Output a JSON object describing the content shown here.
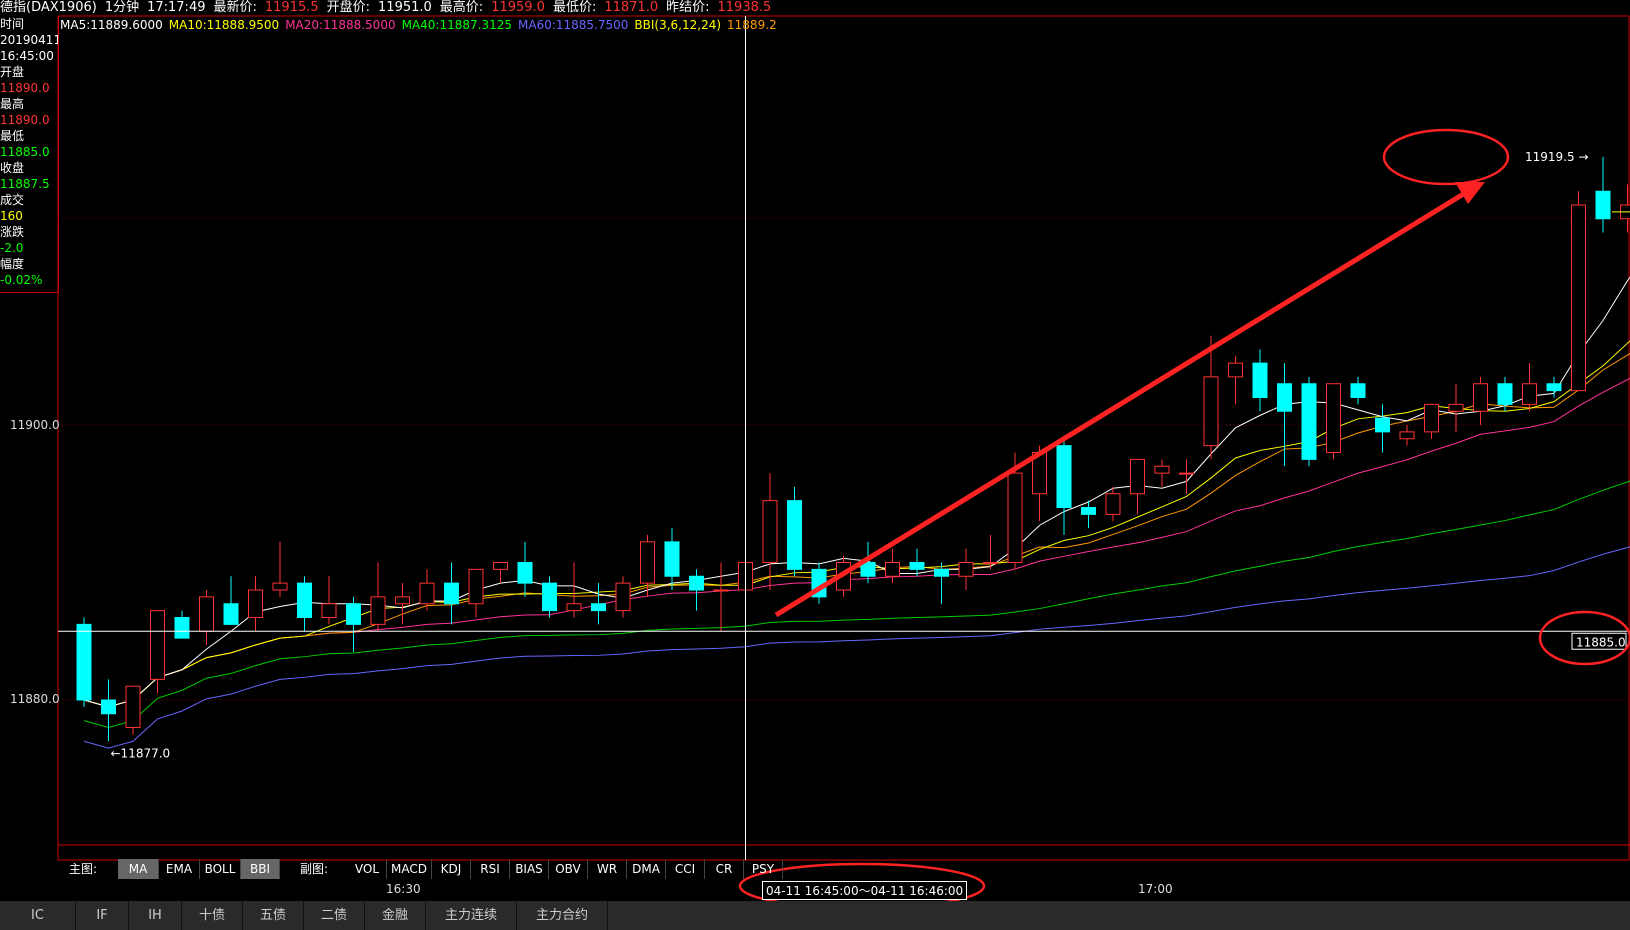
{
  "header": {
    "instrument": "德指(DAX1906)",
    "interval": "1分钟",
    "time": "17:17:49",
    "latest_label": "最新价:",
    "latest_value": "11915.5",
    "open_label": "开盘价:",
    "open_value": "11951.0",
    "high_label": "最高价:",
    "high_value": "11959.0",
    "low_label": "最低价:",
    "low_value": "11871.0",
    "prev_label": "昨结价:",
    "prev_value": "11938.5"
  },
  "indicators": [
    {
      "text": "MA5:11889.6000",
      "color": "#ffffff"
    },
    {
      "text": "MA10:11888.9500",
      "color": "#ffff00"
    },
    {
      "text": "MA20:11888.5000",
      "color": "#ff3399"
    },
    {
      "text": "MA40:11887.3125",
      "color": "#00ff00"
    },
    {
      "text": "MA60:11885.7500",
      "color": "#6666ff"
    },
    {
      "text": "BBI(3,6,12,24)",
      "color": "#ffff00"
    },
    {
      "text": "11889.2",
      "color": "#ff9900"
    }
  ],
  "info_panel": {
    "time_label": "时间",
    "date": "20190411",
    "time": "16:45:00",
    "open_label": "开盘",
    "open": "11890.0",
    "high_label": "最高",
    "high": "11890.0",
    "low_label": "最低",
    "low": "11885.0",
    "close_label": "收盘",
    "close": "11887.5",
    "volume_label": "成交",
    "volume": "160",
    "change_label": "涨跌",
    "change": "-2.0",
    "pct_label": "幅度",
    "pct": "-0.02%"
  },
  "price_axis": {
    "tick1": "11900.0",
    "tick2": "11880.0"
  },
  "annotations": {
    "high_marker": "11919.5",
    "low_marker": "11877.0",
    "crosshair_price": "11885.0",
    "crosshair_time_range": "04-11  16:45:00〜04-11 16:46:00"
  },
  "tabs": {
    "main_label": "主图:",
    "main_items": [
      "MA",
      "EMA",
      "BOLL",
      "BBI"
    ],
    "sub_label": "副图:",
    "sub_items": [
      "VOL",
      "MACD",
      "KDJ",
      "RSI",
      "BIAS",
      "OBV",
      "WR",
      "DMA",
      "CCI",
      "CR",
      "PSY"
    ]
  },
  "time_axis": {
    "t1": "16:30",
    "t2": "17:00"
  },
  "footer": [
    "IC",
    "IF",
    "IH",
    "十债",
    "五债",
    "二债",
    "金融",
    "主力连续",
    "主力合约"
  ],
  "chart_data": {
    "type": "candlestick",
    "y_ticks": [
      11900.0,
      11880.0
    ],
    "x_ticks": [
      "16:30",
      "17:00"
    ],
    "candles": [
      {
        "o": 11885.5,
        "h": 11886.0,
        "l": 11879.5,
        "c": 11880.0
      },
      {
        "o": 11880.0,
        "h": 11881.5,
        "l": 11877.0,
        "c": 11879.0
      },
      {
        "o": 11878.0,
        "h": 11881.0,
        "l": 11877.5,
        "c": 11881.0
      },
      {
        "o": 11881.5,
        "h": 11886.5,
        "l": 11880.5,
        "c": 11886.5
      },
      {
        "o": 11886.0,
        "h": 11886.5,
        "l": 11884.5,
        "c": 11884.5
      },
      {
        "o": 11885.0,
        "h": 11888.0,
        "l": 11884.0,
        "c": 11887.5
      },
      {
        "o": 11887.0,
        "h": 11889.0,
        "l": 11885.5,
        "c": 11885.5
      },
      {
        "o": 11886.0,
        "h": 11889.0,
        "l": 11885.0,
        "c": 11888.0
      },
      {
        "o": 11888.0,
        "h": 11891.5,
        "l": 11887.5,
        "c": 11888.5
      },
      {
        "o": 11888.5,
        "h": 11889.0,
        "l": 11885.0,
        "c": 11886.0
      },
      {
        "o": 11886.0,
        "h": 11889.0,
        "l": 11885.5,
        "c": 11887.0
      },
      {
        "o": 11887.0,
        "h": 11887.5,
        "l": 11883.5,
        "c": 11885.5
      },
      {
        "o": 11885.5,
        "h": 11890.0,
        "l": 11885.0,
        "c": 11887.5
      },
      {
        "o": 11887.0,
        "h": 11888.5,
        "l": 11885.5,
        "c": 11887.5
      },
      {
        "o": 11887.0,
        "h": 11889.5,
        "l": 11886.5,
        "c": 11888.5
      },
      {
        "o": 11888.5,
        "h": 11890.0,
        "l": 11885.5,
        "c": 11887.0
      },
      {
        "o": 11887.0,
        "h": 11889.5,
        "l": 11886.0,
        "c": 11889.5
      },
      {
        "o": 11889.5,
        "h": 11890.0,
        "l": 11888.5,
        "c": 11890.0
      },
      {
        "o": 11890.0,
        "h": 11891.5,
        "l": 11887.5,
        "c": 11888.5
      },
      {
        "o": 11888.5,
        "h": 11889.0,
        "l": 11886.0,
        "c": 11886.5
      },
      {
        "o": 11886.5,
        "h": 11890.0,
        "l": 11886.0,
        "c": 11887.0
      },
      {
        "o": 11887.0,
        "h": 11888.5,
        "l": 11885.5,
        "c": 11886.5
      },
      {
        "o": 11886.5,
        "h": 11889.0,
        "l": 11886.0,
        "c": 11888.5
      },
      {
        "o": 11888.5,
        "h": 11892.0,
        "l": 11887.5,
        "c": 11891.5
      },
      {
        "o": 11891.5,
        "h": 11892.5,
        "l": 11888.0,
        "c": 11889.0
      },
      {
        "o": 11889.0,
        "h": 11889.5,
        "l": 11886.5,
        "c": 11888.0
      },
      {
        "o": 11888.0,
        "h": 11890.0,
        "l": 11885.0,
        "c": 11888.0
      },
      {
        "o": 11888.0,
        "h": 11891.0,
        "l": 11887.5,
        "c": 11890.0
      },
      {
        "o": 11890.0,
        "h": 11896.5,
        "l": 11888.0,
        "c": 11894.5
      },
      {
        "o": 11894.5,
        "h": 11895.5,
        "l": 11889.0,
        "c": 11889.5
      },
      {
        "o": 11889.5,
        "h": 11890.0,
        "l": 11887.0,
        "c": 11887.5
      },
      {
        "o": 11888.0,
        "h": 11890.5,
        "l": 11887.5,
        "c": 11890.0
      },
      {
        "o": 11890.0,
        "h": 11891.5,
        "l": 11888.5,
        "c": 11889.0
      },
      {
        "o": 11889.0,
        "h": 11891.0,
        "l": 11888.5,
        "c": 11890.0
      },
      {
        "o": 11890.0,
        "h": 11891.0,
        "l": 11889.0,
        "c": 11889.5
      },
      {
        "o": 11889.5,
        "h": 11890.0,
        "l": 11887.0,
        "c": 11889.0
      },
      {
        "o": 11889.0,
        "h": 11891.0,
        "l": 11888.0,
        "c": 11890.0
      },
      {
        "o": 11890.0,
        "h": 11892.0,
        "l": 11889.5,
        "c": 11890.0
      },
      {
        "o": 11890.0,
        "h": 11898.0,
        "l": 11889.5,
        "c": 11896.5
      },
      {
        "o": 11895.0,
        "h": 11898.5,
        "l": 11893.0,
        "c": 11898.0
      },
      {
        "o": 11898.5,
        "h": 11899.0,
        "l": 11892.0,
        "c": 11894.0
      },
      {
        "o": 11894.0,
        "h": 11894.5,
        "l": 11892.5,
        "c": 11893.5
      },
      {
        "o": 11893.5,
        "h": 11895.5,
        "l": 11893.0,
        "c": 11895.0
      },
      {
        "o": 11895.0,
        "h": 11897.5,
        "l": 11893.5,
        "c": 11897.5
      },
      {
        "o": 11896.5,
        "h": 11897.5,
        "l": 11895.5,
        "c": 11897.0
      },
      {
        "o": 11896.5,
        "h": 11897.5,
        "l": 11895.0,
        "c": 11896.5
      },
      {
        "o": 11898.5,
        "h": 11906.5,
        "l": 11897.5,
        "c": 11903.5
      },
      {
        "o": 11903.5,
        "h": 11905.0,
        "l": 11901.5,
        "c": 11904.5
      },
      {
        "o": 11904.5,
        "h": 11905.5,
        "l": 11901.0,
        "c": 11902.0
      },
      {
        "o": 11903.0,
        "h": 11904.5,
        "l": 11897.0,
        "c": 11901.0
      },
      {
        "o": 11903.0,
        "h": 11903.5,
        "l": 11897.0,
        "c": 11897.5
      },
      {
        "o": 11898.0,
        "h": 11903.0,
        "l": 11897.5,
        "c": 11903.0
      },
      {
        "o": 11903.0,
        "h": 11903.5,
        "l": 11901.5,
        "c": 11902.0
      },
      {
        "o": 11900.5,
        "h": 11901.5,
        "l": 11898.0,
        "c": 11899.5
      },
      {
        "o": 11899.0,
        "h": 11900.0,
        "l": 11898.5,
        "c": 11899.5
      },
      {
        "o": 11899.5,
        "h": 11901.5,
        "l": 11899.0,
        "c": 11901.5
      },
      {
        "o": 11901.0,
        "h": 11903.0,
        "l": 11899.5,
        "c": 11901.5
      },
      {
        "o": 11901.0,
        "h": 11903.5,
        "l": 11900.0,
        "c": 11903.0
      },
      {
        "o": 11903.0,
        "h": 11903.5,
        "l": 11901.0,
        "c": 11901.5
      },
      {
        "o": 11901.5,
        "h": 11904.5,
        "l": 11901.0,
        "c": 11903.0
      },
      {
        "o": 11903.0,
        "h": 11903.5,
        "l": 11902.0,
        "c": 11902.5
      },
      {
        "o": 11902.5,
        "h": 11917.0,
        "l": 11902.5,
        "c": 11916.0
      },
      {
        "o": 11917.0,
        "h": 11919.5,
        "l": 11914.0,
        "c": 11915.0
      },
      {
        "o": 11915.0,
        "h": 11917.5,
        "l": 11914.0,
        "c": 11916.0
      },
      {
        "o": 11915.5,
        "h": 11917.5,
        "l": 11914.0,
        "c": 11915.5
      }
    ]
  }
}
